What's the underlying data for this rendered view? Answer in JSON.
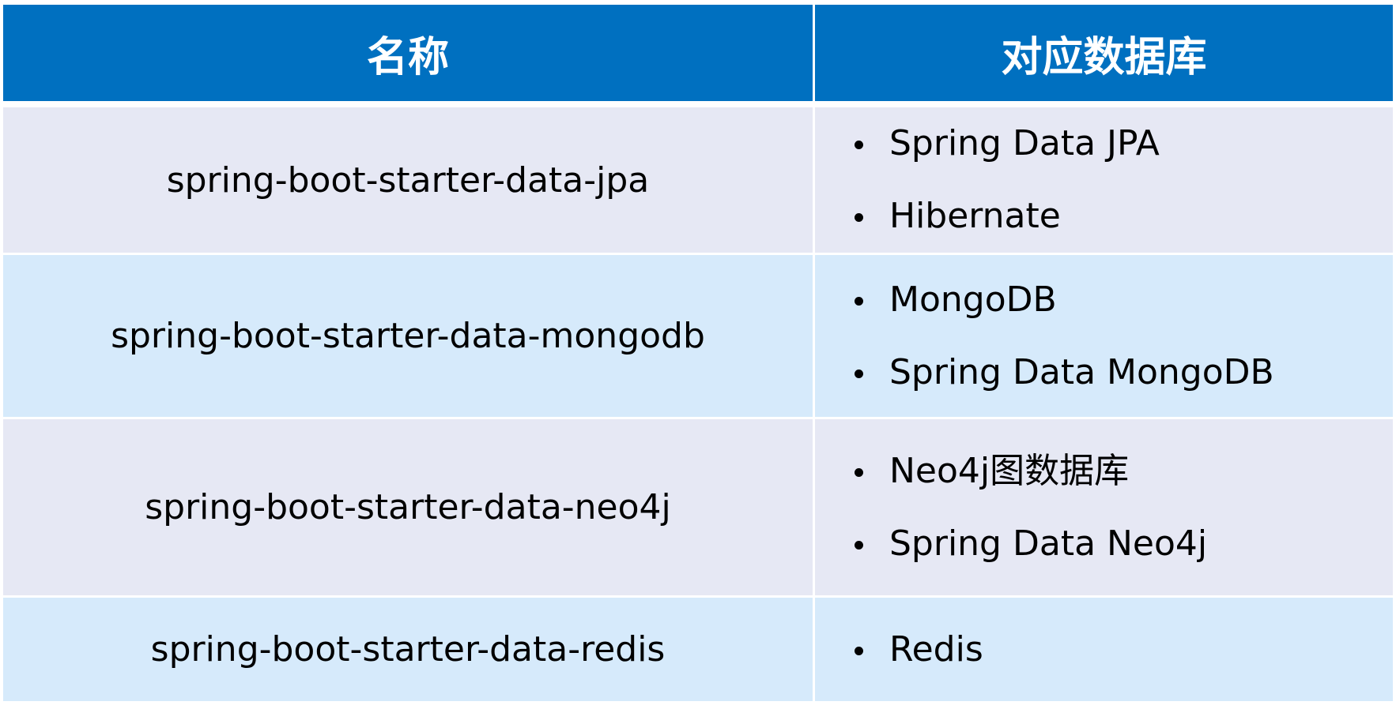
{
  "table": {
    "headers": [
      "名称",
      "对应数据库"
    ],
    "rows": [
      {
        "name": "spring-boot-starter-data-jpa",
        "databases": [
          "Spring Data JPA",
          "Hibernate"
        ]
      },
      {
        "name": "spring-boot-starter-data-mongodb",
        "databases": [
          "MongoDB",
          "Spring Data MongoDB"
        ]
      },
      {
        "name": "spring-boot-starter-data-neo4j",
        "databases": [
          "Neo4j图数据库",
          "Spring Data Neo4j"
        ]
      },
      {
        "name": "spring-boot-starter-data-redis",
        "databases": [
          "Redis"
        ]
      }
    ]
  },
  "colors": {
    "header": "#0070C0",
    "row_odd": "#E6E8F4",
    "row_even": "#D6EAFB"
  }
}
